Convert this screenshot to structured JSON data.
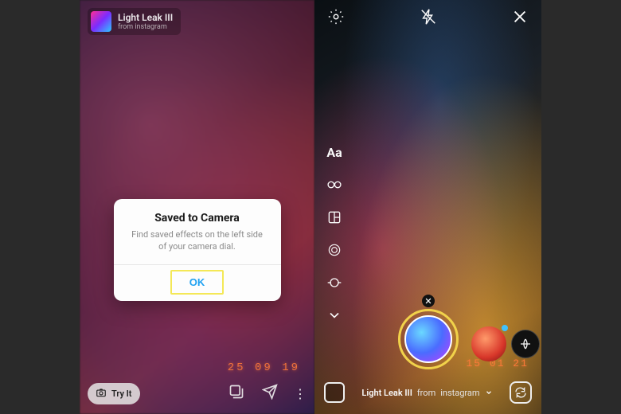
{
  "left": {
    "effect_chip": {
      "title": "Light Leak III",
      "subtitle": "from instagram"
    },
    "dialog": {
      "title": "Saved to Camera",
      "body": "Find saved effects on the left side of your camera dial.",
      "ok_label": "OK"
    },
    "datestamp": "25 09 19",
    "try_it_label": "Try It"
  },
  "right": {
    "side_tools": {
      "text_label": "Aa"
    },
    "datestamp": "15 01 21",
    "effect_label": {
      "name": "Light Leak III",
      "from_word": "from",
      "source": "instagram"
    }
  }
}
